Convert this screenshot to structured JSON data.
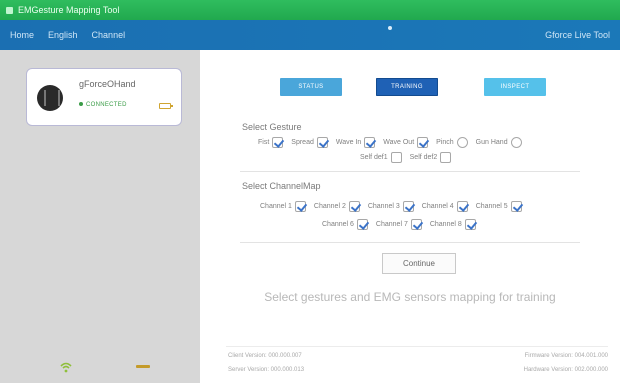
{
  "window": {
    "title": "EMGesture Mapping Tool"
  },
  "menu": {
    "items": [
      "Home",
      "English",
      "Channel"
    ],
    "right_label": "Gforce Live Tool"
  },
  "device": {
    "name": "gForceOHand",
    "status": "CONNECTED"
  },
  "modes": {
    "status": "STATUS",
    "training": "TRAINING",
    "inspect": "INSPECT",
    "active": "TRAINING"
  },
  "gesture_section": {
    "title": "Select Gesture",
    "row1": [
      {
        "label": "Fist",
        "checked": true
      },
      {
        "label": "Spread",
        "checked": true
      },
      {
        "label": "Wave In",
        "checked": true
      },
      {
        "label": "Wave Out",
        "checked": true
      },
      {
        "label": "Pinch",
        "checked": false
      },
      {
        "label": "Gun Hand",
        "checked": false
      }
    ],
    "row2": [
      {
        "label": "Self def1",
        "checked": false
      },
      {
        "label": "Self def2",
        "checked": false
      }
    ]
  },
  "channel_section": {
    "title": "Select ChannelMap",
    "row1": [
      {
        "label": "Channel 1",
        "checked": true
      },
      {
        "label": "Channel 2",
        "checked": true
      },
      {
        "label": "Channel 3",
        "checked": true
      },
      {
        "label": "Channel 4",
        "checked": true
      },
      {
        "label": "Channel 5",
        "checked": true
      }
    ],
    "row2": [
      {
        "label": "Channel 6",
        "checked": true
      },
      {
        "label": "Channel 7",
        "checked": true
      },
      {
        "label": "Channel 8",
        "checked": true
      }
    ]
  },
  "continue_label": "Continue",
  "hint": "Select gestures and EMG sensors mapping for training",
  "footer": {
    "client_version": "Client Version: 000.000.007",
    "server_version": "Server Version: 000.000.013",
    "firmware_version": "Firmware Version: 004.001.000",
    "hardware_version": "Hardware Version: 002.000.000"
  }
}
